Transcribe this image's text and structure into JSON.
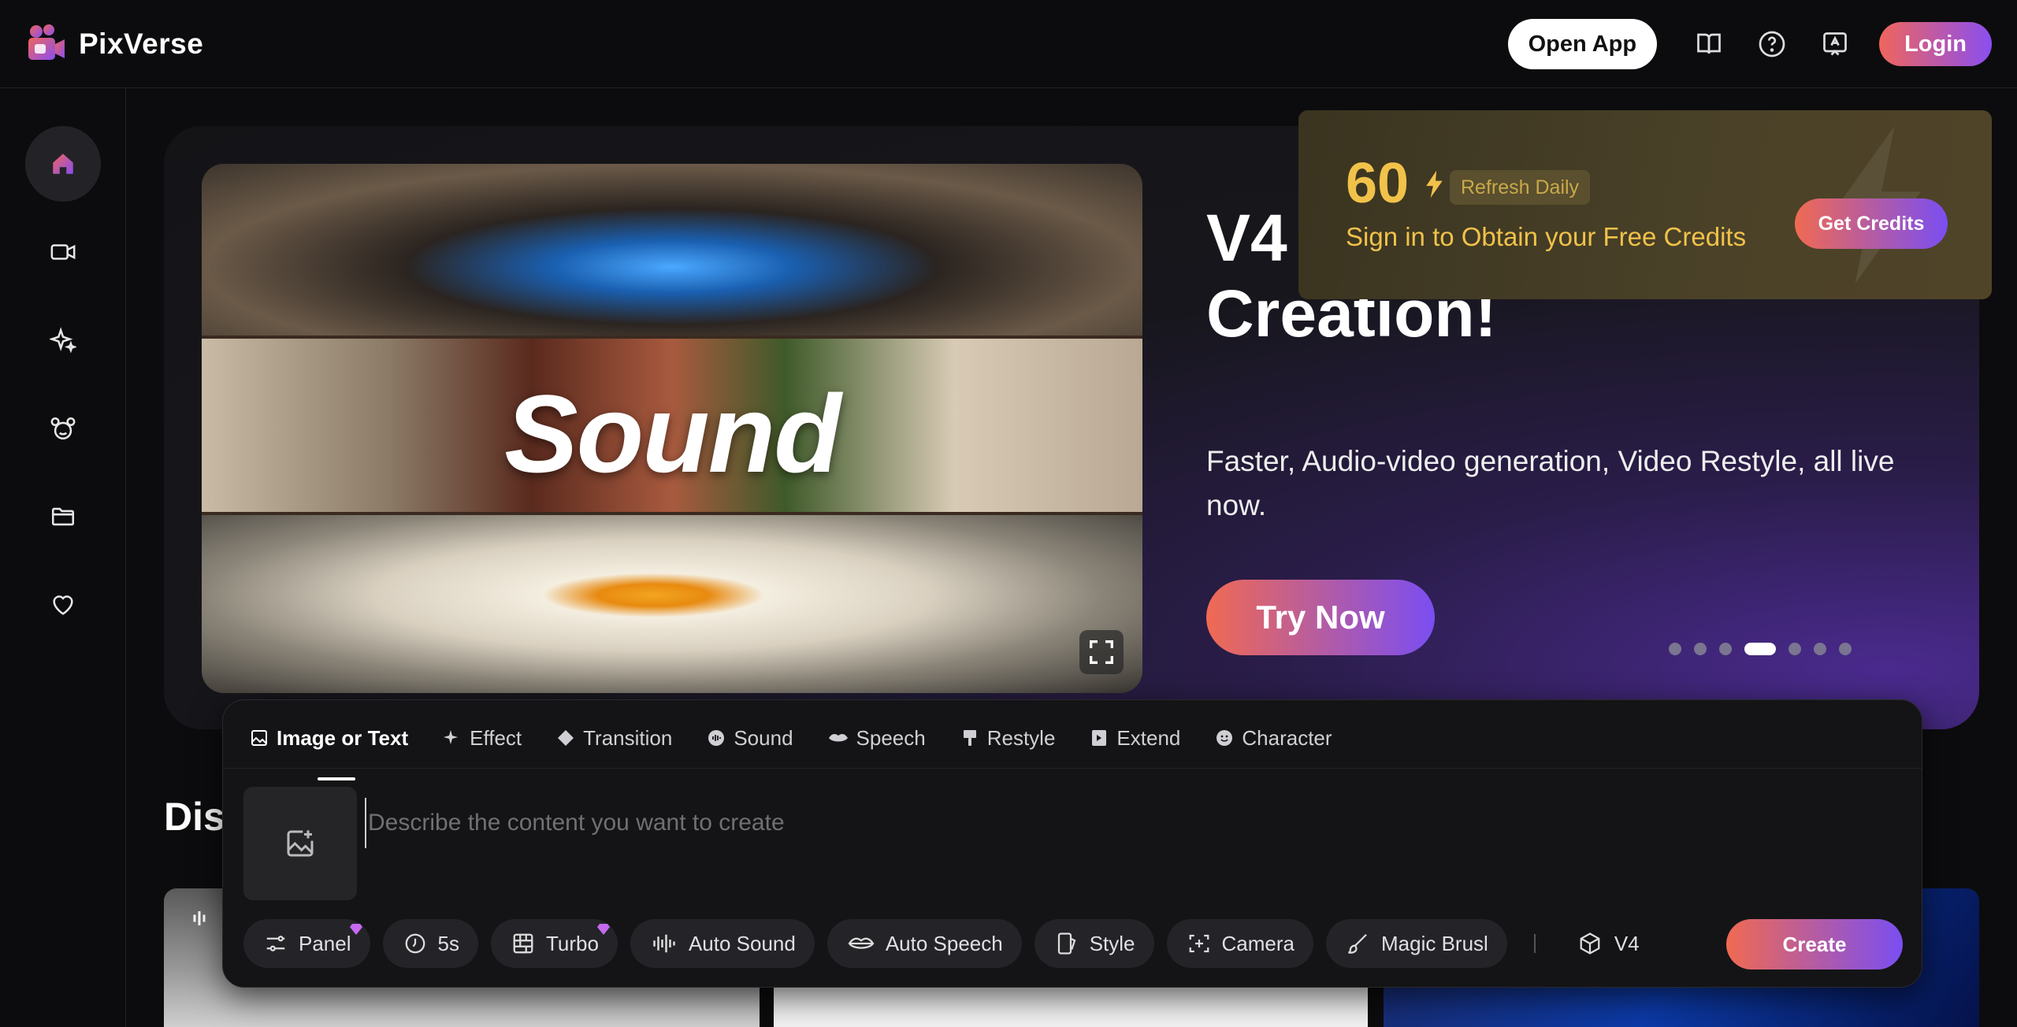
{
  "app": {
    "brand": "PixVerse",
    "open_app_label": "Open App",
    "login_label": "Login",
    "brand_gradient": [
      "#f0655c",
      "#8a4ef0"
    ]
  },
  "top_icons": [
    "book-icon",
    "help-icon",
    "feedback-icon"
  ],
  "sidebar": {
    "items": [
      {
        "name": "home",
        "icon": "home-icon",
        "active": true
      },
      {
        "name": "video",
        "icon": "video-icon",
        "active": false
      },
      {
        "name": "sparkle",
        "icon": "sparkle-icon",
        "active": false
      },
      {
        "name": "character",
        "icon": "mickey-icon",
        "active": false
      },
      {
        "name": "assets",
        "icon": "folder-icon",
        "active": false
      },
      {
        "name": "favorites",
        "icon": "heart-icon",
        "active": false
      }
    ]
  },
  "hero": {
    "media_text": "Sound",
    "title": "V4 Redefining Video Creation!",
    "subtitle": "Faster, Audio-video generation, Video Restyle, all live now.",
    "cta": "Try Now",
    "slide_count": 7,
    "active_slide": 4
  },
  "credits": {
    "amount": "60",
    "refresh": "Refresh Daily",
    "message": "Sign in to Obtain your Free Credits",
    "cta": "Get Credits",
    "accent": "#f1c24a"
  },
  "discover": {
    "title": "Dis"
  },
  "panel": {
    "tabs": [
      {
        "label": "Image or Text",
        "icon": "image-icon",
        "active": true
      },
      {
        "label": "Effect",
        "icon": "sparkle-icon",
        "active": false
      },
      {
        "label": "Transition",
        "icon": "transition-icon",
        "active": false
      },
      {
        "label": "Sound",
        "icon": "sound-icon",
        "active": false
      },
      {
        "label": "Speech",
        "icon": "lips-icon",
        "active": false
      },
      {
        "label": "Restyle",
        "icon": "brush-icon",
        "active": false
      },
      {
        "label": "Extend",
        "icon": "extend-icon",
        "active": false
      },
      {
        "label": "Character",
        "icon": "face-icon",
        "active": false
      }
    ],
    "prompt_placeholder": "Describe the content you want to create",
    "tools": [
      {
        "label": "Panel",
        "icon": "sliders-icon",
        "premium": true
      },
      {
        "label": "5s",
        "icon": "clock-icon",
        "premium": false
      },
      {
        "label": "Turbo",
        "icon": "turbo-icon",
        "premium": true
      },
      {
        "label": "Auto Sound",
        "icon": "waveform-icon",
        "premium": false
      },
      {
        "label": "Auto Speech",
        "icon": "lips-icon",
        "premium": false
      },
      {
        "label": "Style",
        "icon": "style-icon",
        "premium": false
      },
      {
        "label": "Camera",
        "icon": "camera-icon",
        "premium": false
      },
      {
        "label": "Magic Brusl",
        "icon": "magic-brush-icon",
        "premium": false
      }
    ],
    "model": "V4",
    "create_label": "Create"
  }
}
